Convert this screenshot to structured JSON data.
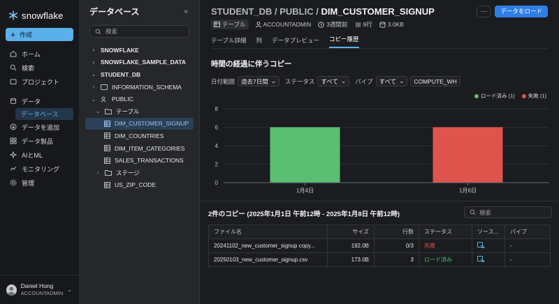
{
  "nav": {
    "logo": "snowflake",
    "create": "作成",
    "items": [
      {
        "label": "ホーム",
        "icon": "home-icon"
      },
      {
        "label": "検索",
        "icon": "search-icon"
      },
      {
        "label": "プロジェクト",
        "icon": "folder-icon"
      }
    ],
    "data_label": "データ",
    "data_sub": "データベース",
    "items2": [
      {
        "label": "データを追加",
        "icon": "download-icon"
      },
      {
        "label": "データ製品",
        "icon": "grid-icon"
      },
      {
        "label": "AIとML",
        "icon": "ai-icon"
      },
      {
        "label": "モニタリング",
        "icon": "monitor-icon"
      },
      {
        "label": "管理",
        "icon": "gear-icon"
      }
    ],
    "user": {
      "name": "Daniel Hong",
      "role": "ACCOUNTADMIN"
    }
  },
  "dbpanel": {
    "title": "データベース",
    "search_placeholder": "検索",
    "tree": [
      {
        "label": "SNOWFLAKE"
      },
      {
        "label": "SNOWFLAKE_SAMPLE_DATA"
      },
      {
        "label": "STUDENT_DB"
      },
      {
        "label": "INFORMATION_SCHEMA"
      },
      {
        "label": "PUBLIC"
      },
      {
        "label": "テーブル"
      },
      {
        "label": "DIM_CUSTOMER_SIGNUP"
      },
      {
        "label": "DIM_COUNTRIES"
      },
      {
        "label": "DIM_ITEM_CATEGORIES"
      },
      {
        "label": "SALES_TRANSACTIONS"
      },
      {
        "label": "ステージ"
      },
      {
        "label": "US_ZIP_CODE"
      }
    ]
  },
  "main": {
    "crumb_prefix": "STUDENT_DB / PUBLIC / ",
    "crumb_table": "DIM_CUSTOMER_SIGNUP",
    "more": "···",
    "load_button": "データをロード",
    "meta": {
      "type": "テーブル",
      "owner": "ACCOUNTADMIN",
      "age": "3週間前",
      "rows": "9行",
      "size": "3.0KB"
    },
    "tabs": [
      "テーブル詳細",
      "列",
      "データプレビュー",
      "コピー履歴"
    ],
    "section_title": "時間の経過に伴うコピー",
    "filters": {
      "date_label": "日付範囲",
      "date_value": "過去7日間",
      "status_label": "ステータス",
      "status_value": "すべて",
      "pipe_label": "パイプ",
      "pipe_value": "すべて",
      "warehouse": "COMPUTE_WH"
    },
    "copies_title": "2件のコピー (2025年1月1日 午前12時 - 2025年1月8日 午前12時)",
    "table_search_placeholder": "検索",
    "table_headers": [
      "ファイル名",
      "サイズ",
      "行数",
      "ステータス",
      "ソース...",
      "パイプ"
    ],
    "rows": [
      {
        "file": "20241102_new_customer_signup copy...",
        "size": "192.0B",
        "rows": "0/3",
        "status": "失敗",
        "pipe": "-"
      },
      {
        "file": "20250103_new_customer_signup.csv",
        "size": "173.0B",
        "rows": "3",
        "status": "ロード済み",
        "pipe": "-"
      }
    ]
  },
  "colors": {
    "success": "#49c06a",
    "failure": "#e0504a",
    "accent": "#5ab0ea"
  },
  "chart_data": {
    "type": "bar",
    "categories": [
      "1月4日",
      "1月6日"
    ],
    "series": [
      {
        "name": "ロード済み (1)",
        "values": [
          6,
          0
        ],
        "color": "#5abf72"
      },
      {
        "name": "失敗 (1)",
        "values": [
          0,
          6
        ],
        "color": "#e0544e"
      }
    ],
    "ylim": [
      0,
      8
    ],
    "yticks": [
      0,
      2,
      4,
      6,
      8
    ],
    "legend": "top-right"
  }
}
